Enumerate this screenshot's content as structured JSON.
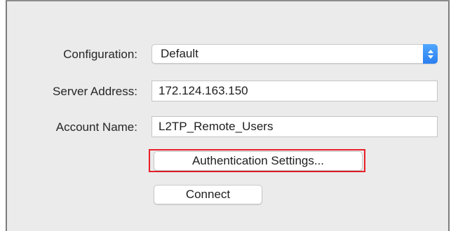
{
  "form": {
    "configuration": {
      "label": "Configuration:",
      "value": "Default",
      "icon": "chevron-up-down-icon",
      "accent_color": "#2b7ff0"
    },
    "server_address": {
      "label": "Server Address:",
      "value": "172.124.163.150"
    },
    "account_name": {
      "label": "Account Name:",
      "value": "L2TP_Remote_Users"
    }
  },
  "buttons": {
    "authentication_settings": "Authentication Settings...",
    "connect": "Connect"
  },
  "highlight_color": "#e8202a"
}
